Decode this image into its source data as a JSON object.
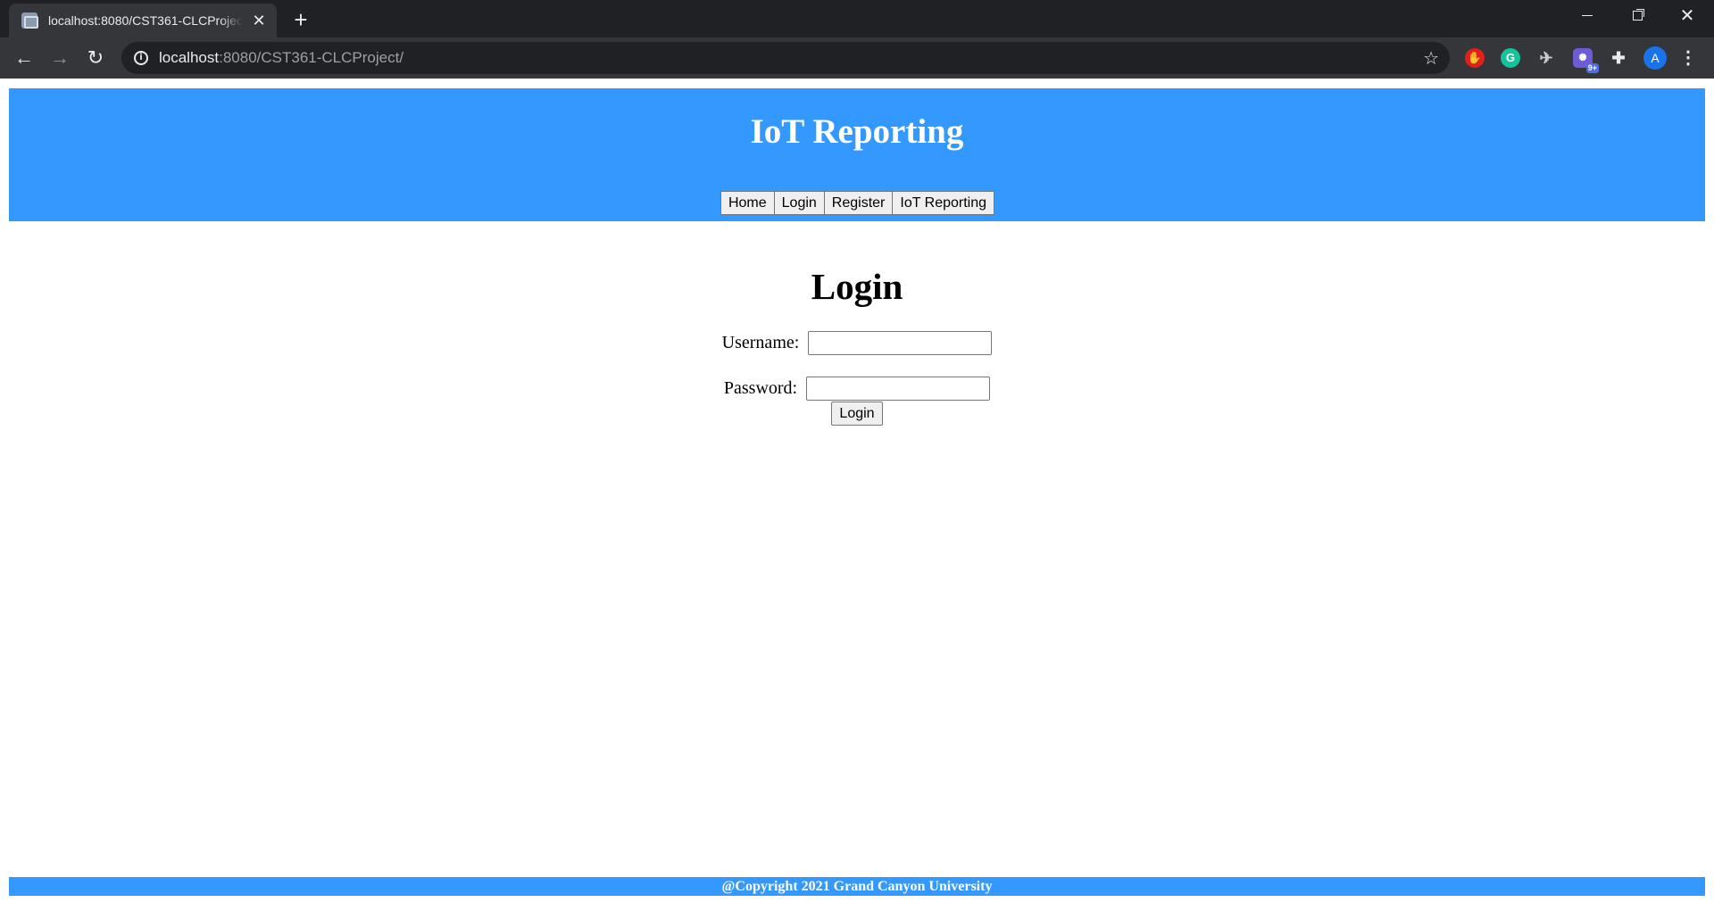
{
  "browser": {
    "tab_title": "localhost:8080/CST361-CLCProject/",
    "tab_close": "✕",
    "new_tab": "+",
    "url_host": "localhost",
    "url_path": ":8080/CST361-CLCProject/",
    "back": "←",
    "forward": "→",
    "reload": "↻",
    "star": "☆",
    "info": "i",
    "window": {
      "minimize": "",
      "maximize": "",
      "close": "✕"
    },
    "extensions": [
      {
        "name": "hand-extension-icon",
        "glyph": "✋"
      },
      {
        "name": "grammarly-icon",
        "glyph": "G"
      },
      {
        "name": "plane-extension-icon",
        "glyph": "✈"
      },
      {
        "name": "badge-extension-icon",
        "glyph": "✺",
        "badge": "9+"
      },
      {
        "name": "puzzle-icon",
        "glyph": "✚"
      }
    ],
    "profile_initial": "A",
    "menu": "⋮"
  },
  "header": {
    "title": "IoT Reporting",
    "nav": [
      {
        "label": "Home"
      },
      {
        "label": "Login"
      },
      {
        "label": "Register"
      },
      {
        "label": "IoT Reporting"
      }
    ],
    "color": "#3399ff"
  },
  "login": {
    "heading": "Login",
    "username_label": "Username:",
    "username_value": "",
    "password_label": "Password:",
    "password_value": "",
    "submit_label": "Login"
  },
  "footer": {
    "text": "@Copyright 2021 Grand Canyon University"
  }
}
